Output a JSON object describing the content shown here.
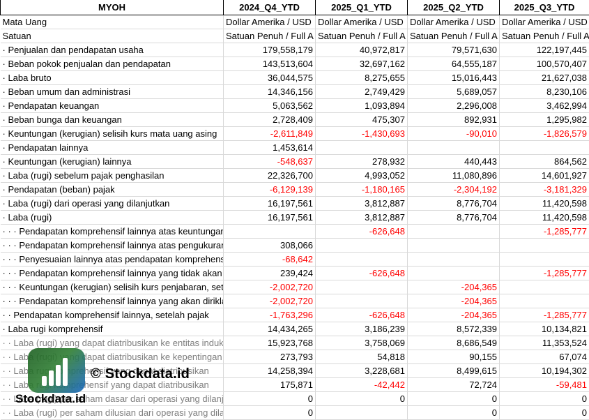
{
  "header": {
    "label": "MYOH",
    "columns": [
      "2024_Q4_YTD",
      "2025_Q1_YTD",
      "2025_Q2_YTD",
      "2025_Q3_YTD"
    ]
  },
  "rows": [
    {
      "label": "Mata Uang",
      "values": [
        "Dollar Amerika / USD",
        "Dollar Amerika / USD",
        "Dollar Amerika / USD",
        "Dollar Amerika / USD"
      ],
      "text": true
    },
    {
      "label": "Satuan",
      "values": [
        "Satuan Penuh / Full A",
        "Satuan Penuh / Full A",
        "Satuan Penuh / Full A",
        "Satuan Penuh / Full A"
      ],
      "text": true
    },
    {
      "label": "· Penjualan dan pendapatan usaha",
      "values": [
        "179,558,179",
        "40,972,817",
        "79,571,630",
        "122,197,445"
      ]
    },
    {
      "label": "· Beban pokok penjualan dan pendapatan",
      "values": [
        "143,513,604",
        "32,697,162",
        "64,555,187",
        "100,570,407"
      ]
    },
    {
      "label": "· Laba bruto",
      "values": [
        "36,044,575",
        "8,275,655",
        "15,016,443",
        "21,627,038"
      ]
    },
    {
      "label": "· Beban umum dan administrasi",
      "values": [
        "14,346,156",
        "2,749,429",
        "5,689,057",
        "8,230,106"
      ]
    },
    {
      "label": "· Pendapatan keuangan",
      "values": [
        "5,063,562",
        "1,093,894",
        "2,296,008",
        "3,462,994"
      ]
    },
    {
      "label": "· Beban bunga dan keuangan",
      "values": [
        "2,728,409",
        "475,307",
        "892,931",
        "1,295,982"
      ]
    },
    {
      "label": "· Keuntungan (kerugian) selisih kurs mata uang asing",
      "values": [
        "-2,611,849",
        "-1,430,693",
        "-90,010",
        "-1,826,579"
      ]
    },
    {
      "label": "· Pendapatan lainnya",
      "values": [
        "1,453,614",
        "",
        "",
        ""
      ]
    },
    {
      "label": "· Keuntungan (kerugian) lainnya",
      "values": [
        "-548,637",
        "278,932",
        "440,443",
        "864,562"
      ]
    },
    {
      "label": "· Laba (rugi) sebelum pajak penghasilan",
      "values": [
        "22,326,700",
        "4,993,052",
        "11,080,896",
        "14,601,927"
      ]
    },
    {
      "label": "· Pendapatan (beban) pajak",
      "values": [
        "-6,129,139",
        "-1,180,165",
        "-2,304,192",
        "-3,181,329"
      ]
    },
    {
      "label": "· Laba (rugi) dari operasi yang dilanjutkan",
      "values": [
        "16,197,561",
        "3,812,887",
        "8,776,704",
        "11,420,598"
      ]
    },
    {
      "label": "· Laba (rugi)",
      "values": [
        "16,197,561",
        "3,812,887",
        "8,776,704",
        "11,420,598"
      ]
    },
    {
      "label": "· · · Pendapatan komprehensif lainnya atas keuntungan (kerugian) hasil re",
      "values": [
        "",
        "-626,648",
        "",
        "-1,285,777"
      ]
    },
    {
      "label": "· · · Pendapatan komprehensif lainnya atas pengukuran",
      "values": [
        "308,066",
        "",
        "",
        ""
      ]
    },
    {
      "label": "· · · Penyesuaian lainnya atas pendapatan komprehensif",
      "values": [
        "-68,642",
        "",
        "",
        ""
      ]
    },
    {
      "label": "· · · Pendapatan komprehensif lainnya yang tidak akan",
      "values": [
        "239,424",
        "-626,648",
        "",
        "-1,285,777"
      ]
    },
    {
      "label": "· · · Keuntungan (kerugian) selisih kurs penjabaran, set",
      "values": [
        "-2,002,720",
        "",
        "-204,365",
        ""
      ]
    },
    {
      "label": "· · · Pendapatan komprehensif lainnya yang akan dirikla",
      "values": [
        "-2,002,720",
        "",
        "-204,365",
        ""
      ]
    },
    {
      "label": "· · Pendapatan komprehensif lainnya, setelah pajak",
      "values": [
        "-1,763,296",
        "-626,648",
        "-204,365",
        "-1,285,777"
      ]
    },
    {
      "label": "· Laba rugi komprehensif",
      "values": [
        "14,434,265",
        "3,186,239",
        "8,572,339",
        "10,134,821"
      ]
    },
    {
      "label": "· · Laba (rugi) yang dapat diatribusikan ke entitas induk",
      "values": [
        "15,923,768",
        "3,758,069",
        "8,686,549",
        "11,353,524"
      ],
      "grey": true
    },
    {
      "label": "· · Laba (rugi) yang dapat diatribusikan ke kepentingan",
      "values": [
        "273,793",
        "54,818",
        "90,155",
        "67,074"
      ],
      "grey": true
    },
    {
      "label": "· · Laba rugi komprehensif yang dapat diatribusikan",
      "values": [
        "14,258,394",
        "3,228,681",
        "8,499,615",
        "10,194,302"
      ],
      "grey": true
    },
    {
      "label": "· · Laba rugi komprehensif yang dapat diatribusikan",
      "values": [
        "175,871",
        "-42,442",
        "72,724",
        "-59,481"
      ],
      "grey": true
    },
    {
      "label": "· · Laba (rugi) per saham dasar dari operasi yang dilanjutkan",
      "values": [
        "0",
        "0",
        "0",
        "0"
      ],
      "grey": true
    },
    {
      "label": "· · Laba (rugi) per saham dilusian dari operasi yang dilanjutkan",
      "values": [
        "0",
        "",
        "0",
        "0"
      ],
      "grey": true
    }
  ],
  "watermark": {
    "big_text": "© Stockdata.id",
    "small_text": "Stockdata.id",
    "icon": "bar-chart-logo-icon"
  },
  "colors": {
    "negative": "#ff0000",
    "grid": "#d9d9d9"
  }
}
